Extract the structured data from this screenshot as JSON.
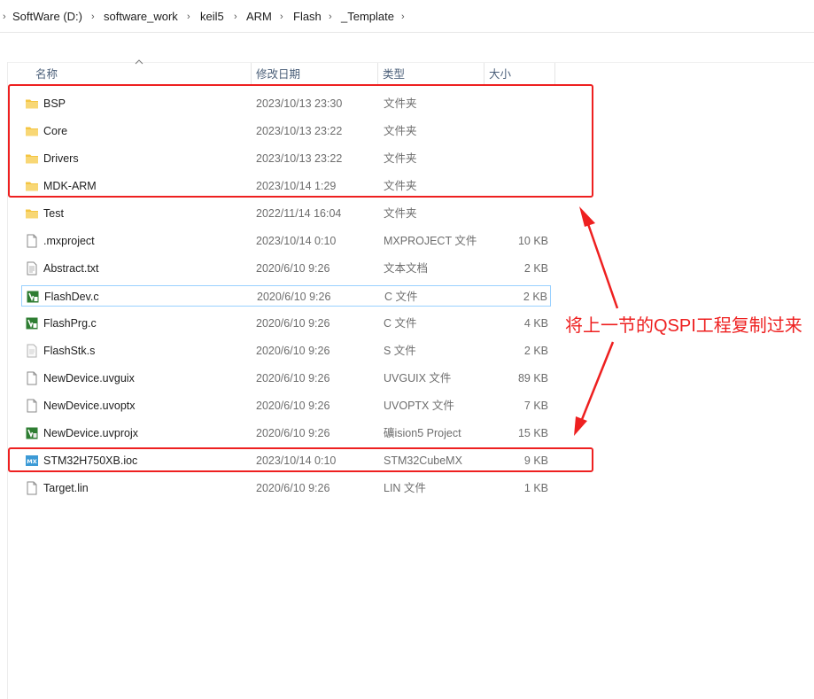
{
  "breadcrumb": {
    "items": [
      "SoftWare (D:)",
      "software_work",
      "keil5",
      "ARM",
      "Flash",
      "_Template"
    ]
  },
  "columns": {
    "name": "名称",
    "modified": "修改日期",
    "type": "类型",
    "size": "大小"
  },
  "files": [
    {
      "name": "BSP",
      "date": "2023/10/13 23:30",
      "type": "文件夹",
      "size": "",
      "icon": "folder-icon"
    },
    {
      "name": "Core",
      "date": "2023/10/13 23:22",
      "type": "文件夹",
      "size": "",
      "icon": "folder-icon"
    },
    {
      "name": "Drivers",
      "date": "2023/10/13 23:22",
      "type": "文件夹",
      "size": "",
      "icon": "folder-icon"
    },
    {
      "name": "MDK-ARM",
      "date": "2023/10/14 1:29",
      "type": "文件夹",
      "size": "",
      "icon": "folder-icon"
    },
    {
      "name": "Test",
      "date": "2022/11/14 16:04",
      "type": "文件夹",
      "size": "",
      "icon": "folder-icon"
    },
    {
      "name": ".mxproject",
      "date": "2023/10/14 0:10",
      "type": "MXPROJECT 文件",
      "size": "10 KB",
      "icon": "file-icon"
    },
    {
      "name": "Abstract.txt",
      "date": "2020/6/10 9:26",
      "type": "文本文档",
      "size": "2 KB",
      "icon": "text-file-icon"
    },
    {
      "name": "FlashDev.c",
      "date": "2020/6/10 9:26",
      "type": "C 文件",
      "size": "2 KB",
      "icon": "keil-file-icon"
    },
    {
      "name": "FlashPrg.c",
      "date": "2020/6/10 9:26",
      "type": "C 文件",
      "size": "4 KB",
      "icon": "keil-file-icon"
    },
    {
      "name": "FlashStk.s",
      "date": "2020/6/10 9:26",
      "type": "S 文件",
      "size": "2 KB",
      "icon": "asm-file-icon"
    },
    {
      "name": "NewDevice.uvguix",
      "date": "2020/6/10 9:26",
      "type": "UVGUIX 文件",
      "size": "89 KB",
      "icon": "file-icon"
    },
    {
      "name": "NewDevice.uvoptx",
      "date": "2020/6/10 9:26",
      "type": "UVOPTX 文件",
      "size": "7 KB",
      "icon": "file-icon"
    },
    {
      "name": "NewDevice.uvprojx",
      "date": "2020/6/10 9:26",
      "type": "礦ision5 Project",
      "size": "15 KB",
      "icon": "keil-project-icon"
    },
    {
      "name": "STM32H750XB.ioc",
      "date": "2023/10/14 0:10",
      "type": "STM32CubeMX",
      "size": "9 KB",
      "icon": "cubemx-icon"
    },
    {
      "name": "Target.lin",
      "date": "2020/6/10 9:26",
      "type": "LIN 文件",
      "size": "1 KB",
      "icon": "file-icon"
    }
  ],
  "selected_row": 7,
  "annotation": {
    "text": "将上一节的QSPI工程复制过来",
    "color": "#ee2020"
  },
  "colors": {
    "folder": "#f4c542",
    "selection_border": "#99d1ff",
    "header_text": "#4c607a",
    "meta_text": "#6d6d6d"
  }
}
